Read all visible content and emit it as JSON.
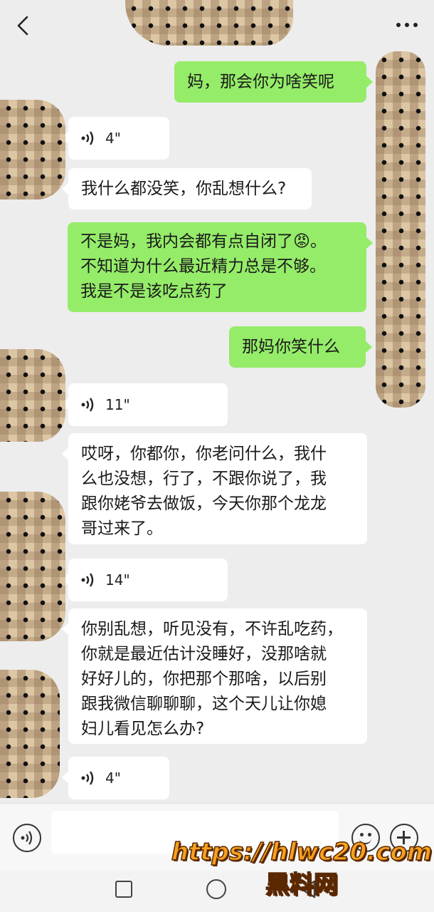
{
  "header": {
    "back_icon": "chevron-left-icon",
    "more_icon": "ellipsis-icon"
  },
  "messages": [
    {
      "type": "text",
      "side": "out",
      "text": "妈，那会你为啥笑呢"
    },
    {
      "type": "voice",
      "side": "in",
      "duration": "4\""
    },
    {
      "type": "text",
      "side": "in",
      "text": "我什么都没笑，你乱想什么?"
    },
    {
      "type": "text",
      "side": "out",
      "lines": [
        "不是妈，我内会都有点自闭了😡。",
        "不知道为什么最近精力总是不够。",
        "我是不是该吃点药了"
      ]
    },
    {
      "type": "text",
      "side": "out",
      "text": "那妈你笑什么"
    },
    {
      "type": "voice",
      "side": "in",
      "duration": "11\""
    },
    {
      "type": "text",
      "side": "in",
      "lines": [
        "哎呀，你都你，你老问什么，我什",
        "么也没想，行了，不跟你说了，我",
        "跟你姥爷去做饭，今天你那个龙龙",
        "哥过来了。"
      ]
    },
    {
      "type": "voice",
      "side": "in",
      "duration": "14\""
    },
    {
      "type": "text",
      "side": "in",
      "lines": [
        "你别乱想，听见没有，不许乱吃药，",
        "你就是最近估计没睡好，没那啥就",
        "好好儿的，你把那个那啥，以后别",
        "跟我微信聊聊聊，这个天儿让你媳",
        "妇儿看见怎么办?"
      ]
    },
    {
      "type": "voice",
      "side": "in",
      "duration": "4\""
    }
  ],
  "input": {
    "placeholder": "",
    "voice_icon": "voice-mode-icon",
    "emoji_icon": "emoji-icon",
    "plus_icon": "plus-icon"
  },
  "navbar": {
    "recent_icon": "square-icon",
    "home_icon": "circle-icon",
    "back_icon": "triangle-back-icon"
  },
  "watermark": {
    "url": "https://hlwc20.com",
    "name": "黑料网"
  },
  "colors": {
    "background": "#ededed",
    "outgoing_bubble": "#95ec69",
    "incoming_bubble": "#ffffff",
    "watermark": "#f7a01f"
  }
}
